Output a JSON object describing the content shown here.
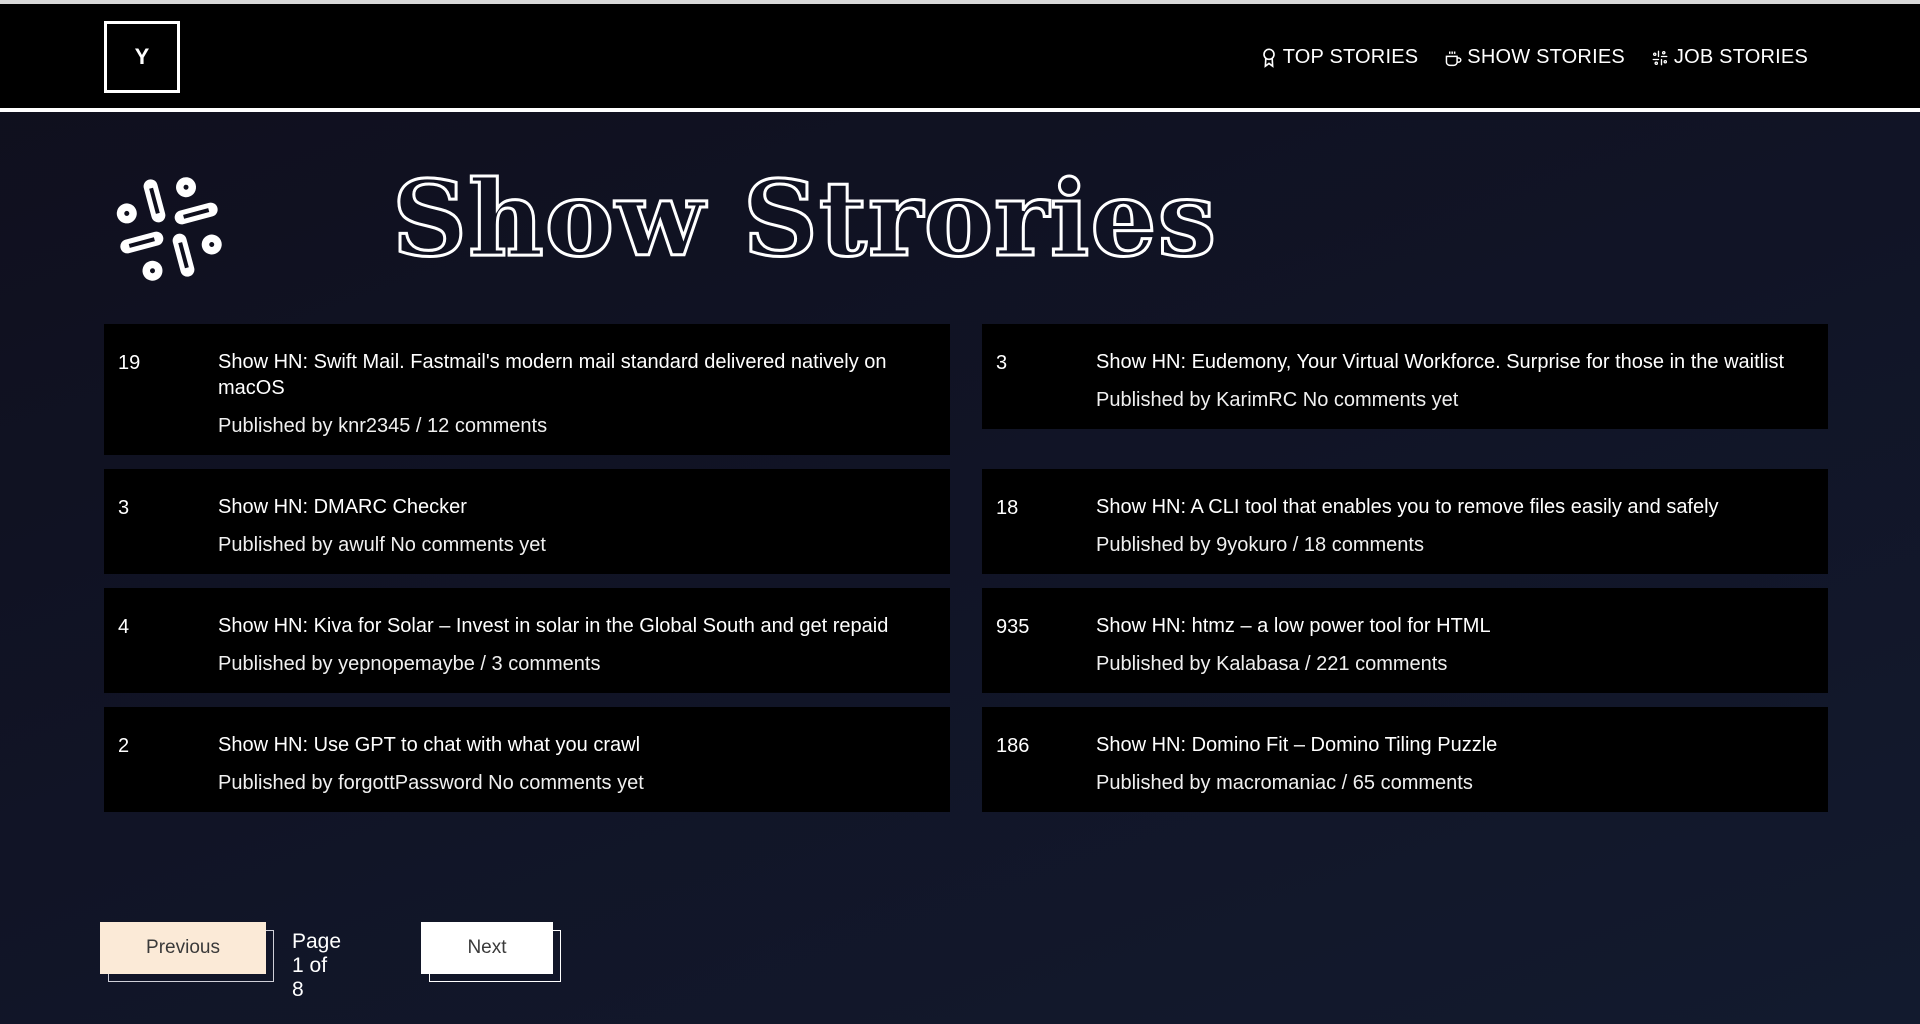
{
  "header": {
    "logo_text": "Y",
    "nav": [
      {
        "label": "TOP STORIES",
        "icon": "award-icon"
      },
      {
        "label": "SHOW STORIES",
        "icon": "coffee-cup-icon"
      },
      {
        "label": "JOB STORIES",
        "icon": "slack-icon"
      }
    ]
  },
  "hero": {
    "icon": "slack-icon",
    "title": "Show Strories"
  },
  "stories": [
    {
      "score": "19",
      "title": "Show HN: Swift Mail. Fastmail's modern mail standard delivered natively on macOS",
      "meta": "Published by knr2345 / 12 comments"
    },
    {
      "score": "3",
      "title": "Show HN: Eudemony, Your Virtual Workforce. Surprise for those in the waitlist",
      "meta": "Published by KarimRC No comments yet"
    },
    {
      "score": "3",
      "title": "Show HN: DMARC Checker",
      "meta": "Published by awulf No comments yet"
    },
    {
      "score": "18",
      "title": "Show HN: A CLI tool that enables you to remove files easily and safely",
      "meta": "Published by 9yokuro / 18 comments"
    },
    {
      "score": "4",
      "title": "Show HN: Kiva for Solar – Invest in solar in the Global South and get repaid",
      "meta": "Published by yepnopemaybe / 3 comments"
    },
    {
      "score": "935",
      "title": "Show HN: htmz – a low power tool for HTML",
      "meta": "Published by Kalabasa / 221 comments"
    },
    {
      "score": "2",
      "title": "Show HN: Use GPT to chat with what you crawl",
      "meta": "Published by forgottPassword No comments yet"
    },
    {
      "score": "186",
      "title": "Show HN: Domino Fit – Domino Tiling Puzzle",
      "meta": "Published by macromaniac / 65 comments"
    }
  ],
  "pagination": {
    "previous_label": "Previous",
    "page_info": "Page 1 of 8",
    "next_label": "Next",
    "current_page": 1,
    "total_pages": 8
  },
  "colors": {
    "header_bg": "#000000",
    "card_bg": "#000000",
    "previous_button_bg": "#fbead7",
    "next_button_bg": "#ffffff"
  }
}
